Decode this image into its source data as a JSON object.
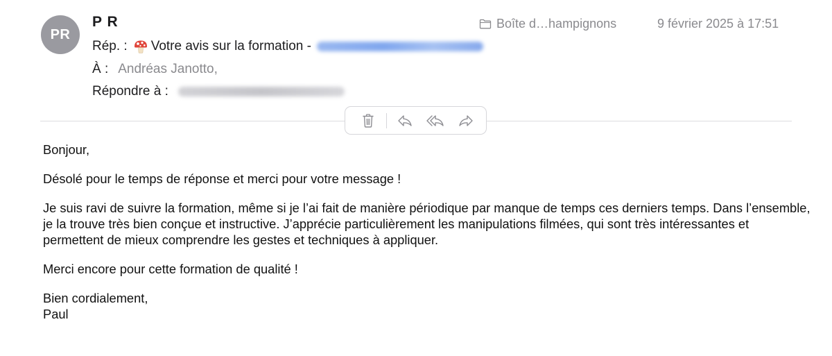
{
  "sender": {
    "initials": "PR",
    "name": "P R"
  },
  "mailbox": {
    "icon": "folder-icon",
    "label": "Boîte d…hampignons"
  },
  "date": "9 février 2025 à 17:51",
  "subject": {
    "prefix": "Rép. :",
    "emoji": "mushroom-icon",
    "text": "Votre avis sur la formation -"
  },
  "to": {
    "label": "À :",
    "value": "Andréas Janotto,"
  },
  "reply_to": {
    "label": "Répondre à :"
  },
  "toolbar": {
    "buttons": [
      "trash-icon",
      "reply-icon",
      "reply-all-icon",
      "forward-icon"
    ]
  },
  "body": {
    "greeting": "Bonjour,",
    "p1": "Désolé pour le temps de réponse et merci pour votre message !",
    "p2": "Je suis ravi de suivre la formation, même si je l’ai fait de manière périodique par manque de temps ces derniers temps. Dans l’ensemble, je la trouve très bien conçue et instructive. J’apprécie particulièrement les manipulations filmées, qui sont très intéressantes et permettent de mieux comprendre les gestes et techniques à appliquer.",
    "p3": "Merci encore pour cette formation de qualité !",
    "closing": "Bien cordialement,",
    "signature": "Paul"
  },
  "colors": {
    "avatar_bg": "#9a9aa0",
    "meta_grey": "#8a8a8e",
    "link_blur": "#7fa6ee"
  }
}
